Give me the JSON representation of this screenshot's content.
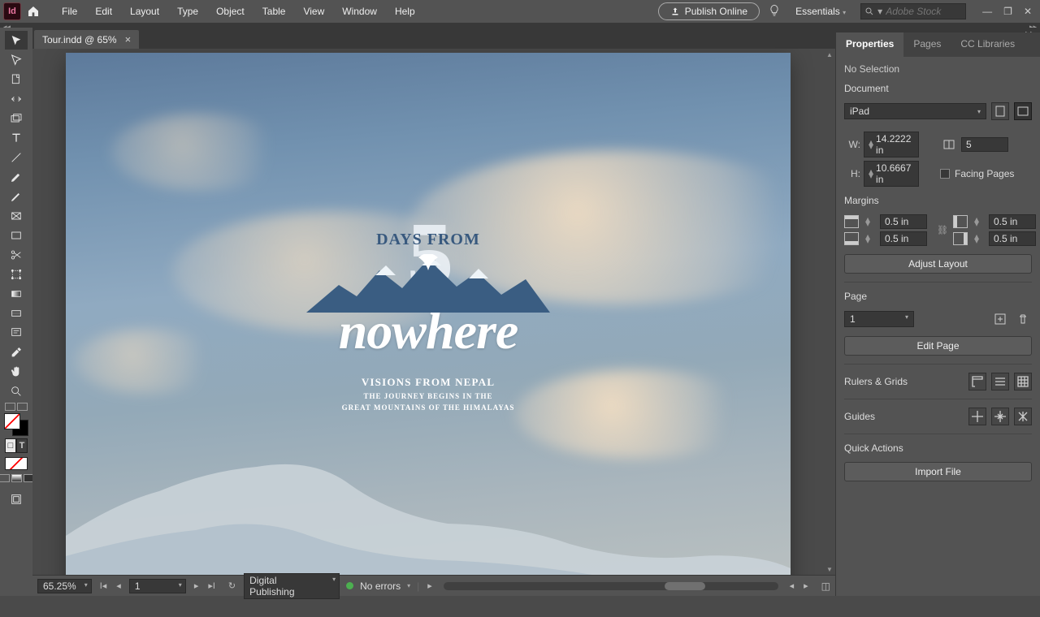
{
  "app": {
    "name_short": "Id"
  },
  "menu": [
    "File",
    "Edit",
    "Layout",
    "Type",
    "Object",
    "Table",
    "View",
    "Window",
    "Help"
  ],
  "topbar": {
    "publish": "Publish Online",
    "workspace": "Essentials",
    "stock_placeholder": "Adobe Stock"
  },
  "document_tab": {
    "label": "Tour.indd @ 65%"
  },
  "artwork": {
    "five": "5",
    "days_from": "DAYS FROM",
    "nowhere": "nowhere",
    "subtitle": "VISIONS FROM NEPAL",
    "caption_line1": "THE JOURNEY BEGINS IN THE",
    "caption_line2": "GREAT MOUNTAINS OF THE HIMALAYAS"
  },
  "statusbar": {
    "zoom": "65.25%",
    "page": "1",
    "intent": "Digital Publishing",
    "errors": "No errors"
  },
  "panel": {
    "tabs": {
      "properties": "Properties",
      "pages": "Pages",
      "cc": "CC Libraries"
    },
    "no_selection": "No Selection",
    "document": {
      "label": "Document",
      "preset": "iPad",
      "W_label": "W:",
      "W": "14.2222 in",
      "H_label": "H:",
      "H": "10.6667 in",
      "pages_lbl_icon": "pages",
      "pages": "5",
      "facing": "Facing Pages"
    },
    "margins": {
      "label": "Margins",
      "top": "0.5 in",
      "bottom": "0.5 in",
      "left": "0.5 in",
      "right": "0.5 in",
      "adjust_btn": "Adjust Layout"
    },
    "page_sec": {
      "label": "Page",
      "current": "1",
      "edit_btn": "Edit Page"
    },
    "rulers": {
      "label": "Rulers & Grids"
    },
    "guides": {
      "label": "Guides"
    },
    "quick": {
      "label": "Quick Actions",
      "import_btn": "Import File"
    }
  }
}
